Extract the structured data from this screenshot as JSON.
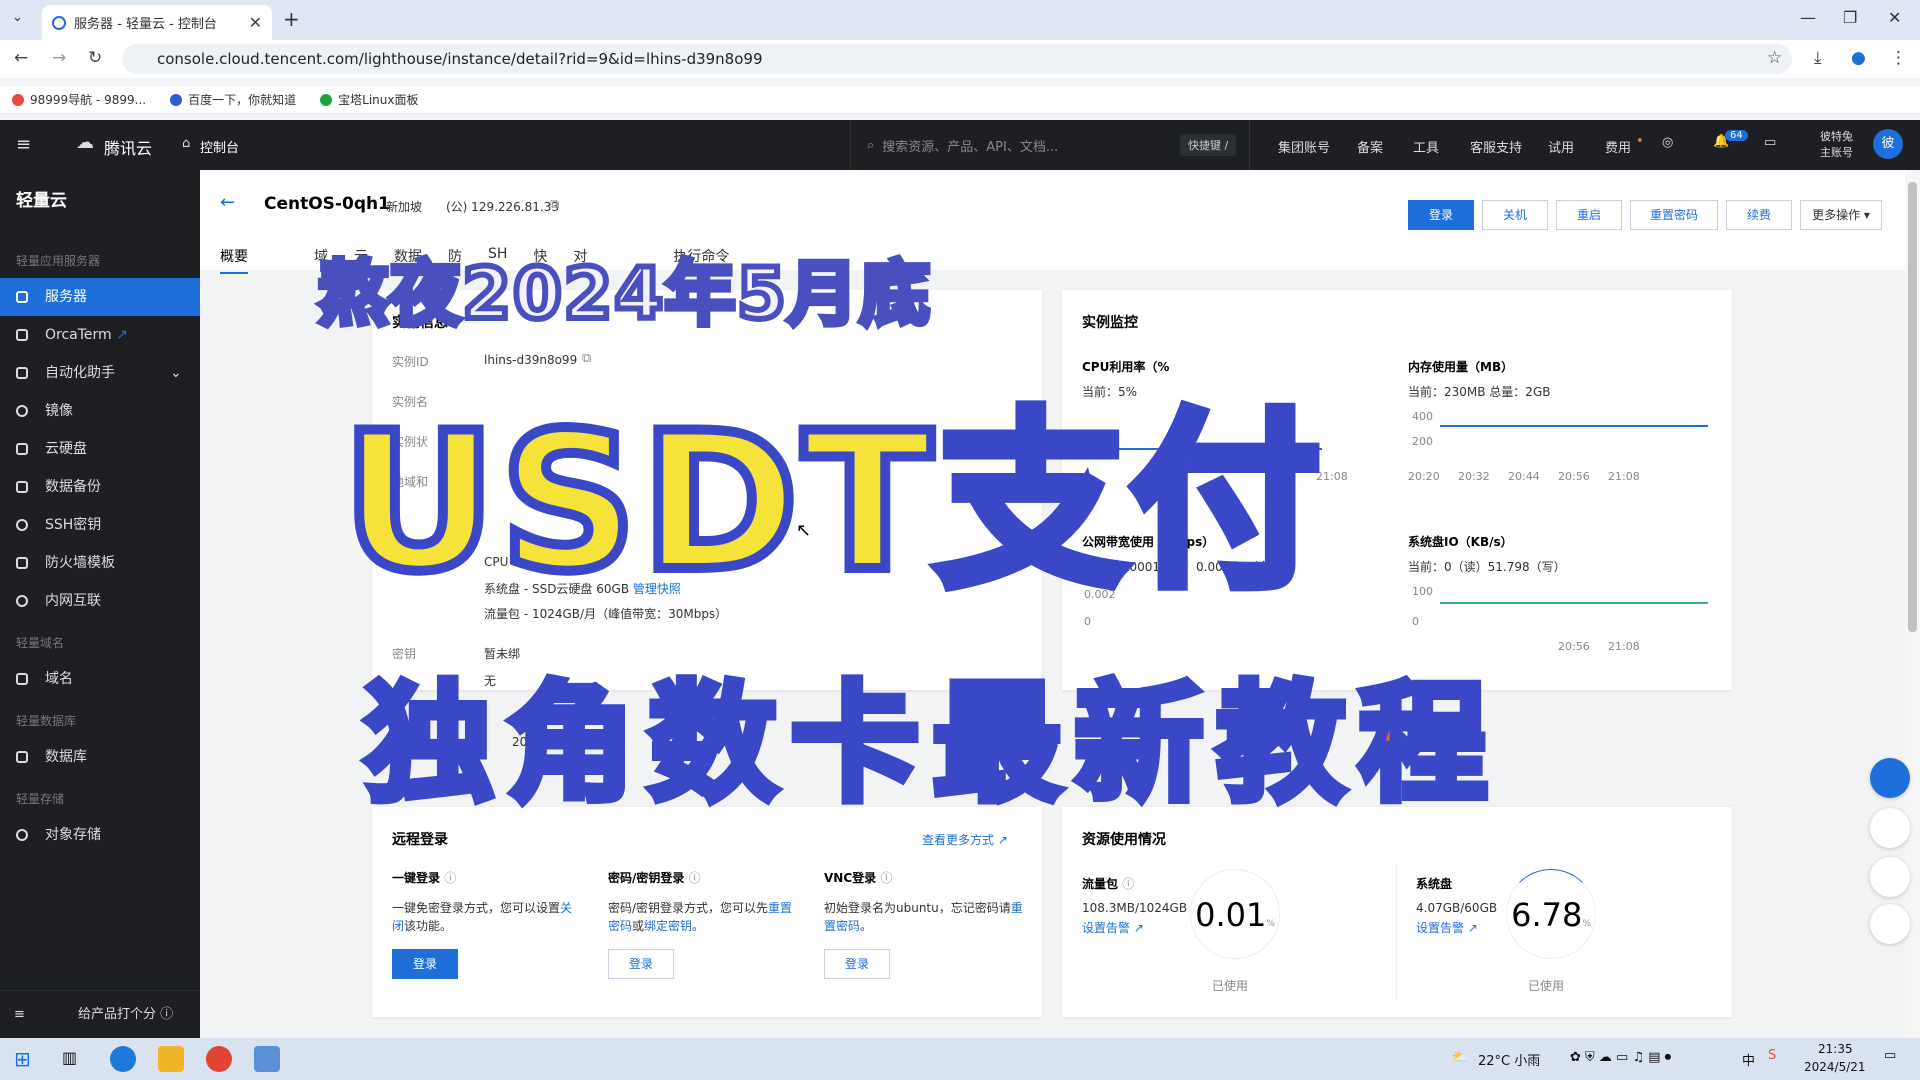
{
  "browser": {
    "tab_title": "服务器 - 轻量云 - 控制台",
    "url": "console.cloud.tencent.com/lighthouse/instance/detail?rid=9&id=lhins-d39n8o99",
    "bookmarks": [
      "98999导航 - 9899...",
      "百度一下，你就知道",
      "宝塔Linux面板"
    ]
  },
  "topnav": {
    "brand": "腾讯云",
    "console": "控制台",
    "search_placeholder": "搜索资源、产品、API、文档...",
    "shortcut": "快捷键 /",
    "items": [
      "集团账号",
      "备案",
      "工具",
      "客服支持",
      "试用",
      "费用"
    ],
    "notif_count": "64",
    "account_line1": "彼特兔",
    "account_line2": "主账号",
    "avatar": "彼"
  },
  "sidebar": {
    "title": "轻量云",
    "sections": {
      "s1": "轻量应用服务器",
      "s2": "轻量域名",
      "s3": "轻量数据库",
      "s4": "轻量存储"
    },
    "items": [
      "服务器",
      "OrcaTerm",
      "自动化助手",
      "镜像",
      "云硬盘",
      "数据备份",
      "SSH密钥",
      "防火墙模板",
      "内网互联",
      "域名",
      "数据库",
      "对象存储"
    ],
    "footer": "给产品打个分"
  },
  "header": {
    "name": "CentOS-0qh1",
    "region": "新加坡",
    "ip": "(公) 129.226.81.33",
    "buttons": [
      "登录",
      "关机",
      "重启",
      "重置密码",
      "续费",
      "更多操作"
    ],
    "tabs": [
      "概要",
      "域",
      "云",
      "数据",
      "防",
      "SH",
      "快",
      "对",
      "执行命令"
    ]
  },
  "instance_info": {
    "title": "实例信息",
    "id_label": "实例ID",
    "id_value": "lhins-d39n8o99",
    "labels": [
      "实例名",
      "实例状",
      "地域和"
    ],
    "disk": "系统盘 - SSD云硬盘 60GB",
    "snapshot_link": "管理快照",
    "traffic": "流量包 - 1024GB/月（峰值带宽：30Mbps）",
    "key_label": "密钥",
    "key_value": "暂未绑",
    "none": "无",
    "cpu": "CPU",
    "year": "20"
  },
  "monitor": {
    "title": "实例监控",
    "cpu_title": "CPU利用率（%",
    "cpu_sub": "当前：5%",
    "mem_title": "内存使用量（MB）",
    "mem_sub": "当前：230MB 总量：2GB",
    "mem_y": [
      "400",
      "200"
    ],
    "times": [
      "20:20",
      "20:32",
      "20:44",
      "20:56",
      "21:08"
    ],
    "net_title": "公网带宽使用（Mbps）",
    "net_sub": "当前：0.0001（入）0.00008（出）",
    "net_y": [
      "0.002",
      "0"
    ],
    "io_title": "系统盘IO（KB/s）",
    "io_sub": "当前：0（读）51.798（写）",
    "io_y": [
      "100",
      "0"
    ]
  },
  "remote": {
    "title": "远程登录",
    "more": "查看更多方式",
    "onekey_title": "一键登录",
    "onekey_desc1": "一键免密登录方式，您可以设置",
    "onekey_desc_link": "关闭",
    "onekey_desc2": "该功能。",
    "pwd_title": "密码/密钥登录",
    "pwd_desc1": "密码/密钥登录方式，您可以先",
    "pwd_link1": "重置密码",
    "pwd_or": "或",
    "pwd_link2": "绑定密钥",
    "vnc_title": "VNC登录",
    "vnc_desc1": "初始登录名为ubuntu，忘记密码请",
    "vnc_link": "重置密码",
    "login": "登录"
  },
  "usage": {
    "title": "资源使用情况",
    "traffic_title": "流量包",
    "traffic_val": "108.3MB/1024GB",
    "traffic_pct": "0.01",
    "disk_title": "系统盘",
    "disk_val": "4.07GB/60GB",
    "disk_pct": "6.78",
    "alert": "设置告警",
    "used": "已使用",
    "pct_sign": "%"
  },
  "overlay": {
    "line1": "熬夜2024年5月底",
    "line2": "USDT支付",
    "line3": "独角数卡最新教程"
  },
  "tray": {
    "weather": "22°C 小雨",
    "ime": "中",
    "time": "21:35",
    "date": "2024/5/21"
  }
}
